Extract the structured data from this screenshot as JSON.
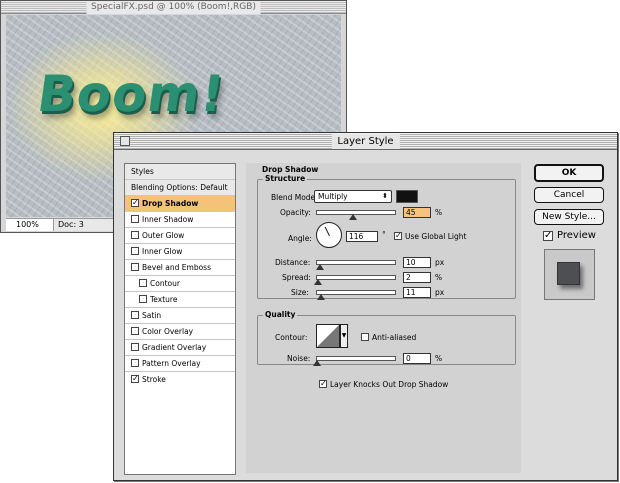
{
  "document": {
    "title": "SpecialFX.psd @ 100% (Boom!,RGB)",
    "canvas_text": "Boom!",
    "zoom": "100%",
    "doc_info": "Doc: 3"
  },
  "dialog": {
    "title": "Layer Style",
    "styles_header": "Styles",
    "blending_options": "Blending Options: Default",
    "styles": [
      {
        "label": "Drop Shadow",
        "checked": true,
        "selected": true
      },
      {
        "label": "Inner Shadow",
        "checked": false
      },
      {
        "label": "Outer Glow",
        "checked": false
      },
      {
        "label": "Inner Glow",
        "checked": false
      },
      {
        "label": "Bevel and Emboss",
        "checked": false
      },
      {
        "label": "Contour",
        "checked": false,
        "indent": true
      },
      {
        "label": "Texture",
        "checked": false,
        "indent": true
      },
      {
        "label": "Satin",
        "checked": false
      },
      {
        "label": "Color Overlay",
        "checked": false
      },
      {
        "label": "Gradient Overlay",
        "checked": false
      },
      {
        "label": "Pattern Overlay",
        "checked": false
      },
      {
        "label": "Stroke",
        "checked": true
      }
    ],
    "drop_shadow": {
      "section_title": "Drop Shadow",
      "structure_title": "Structure",
      "blend_mode_label": "Blend Mode:",
      "blend_mode_value": "Multiply",
      "shadow_color": "#111111",
      "opacity_label": "Opacity:",
      "opacity_value": "45",
      "opacity_unit": "%",
      "angle_label": "Angle:",
      "angle_value": "116",
      "angle_unit": "°",
      "use_global_light_label": "Use Global Light",
      "use_global_light": true,
      "distance_label": "Distance:",
      "distance_value": "10",
      "distance_unit": "px",
      "spread_label": "Spread:",
      "spread_value": "2",
      "spread_unit": "%",
      "size_label": "Size:",
      "size_value": "11",
      "size_unit": "px",
      "quality_title": "Quality",
      "contour_label": "Contour:",
      "anti_aliased_label": "Anti-aliased",
      "anti_aliased": false,
      "noise_label": "Noise:",
      "noise_value": "0",
      "noise_unit": "%",
      "knockout_label": "Layer Knocks Out Drop Shadow",
      "knockout": true
    },
    "buttons": {
      "ok": "OK",
      "cancel": "Cancel",
      "new_style": "New Style...",
      "preview_label": "Preview",
      "preview_checked": true
    },
    "colors": {
      "selected_row": "#f5c27a",
      "highlighted_field": "#f6c47c",
      "boom_text": "#2b8f72"
    }
  }
}
